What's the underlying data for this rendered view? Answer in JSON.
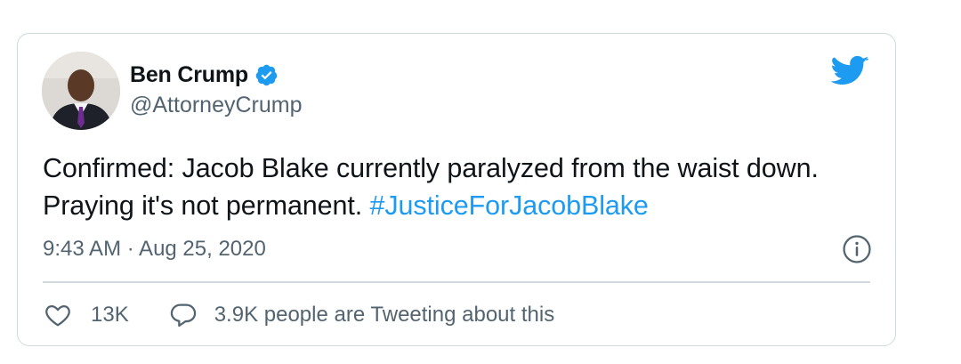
{
  "tweet": {
    "author": {
      "display_name": "Ben Crump",
      "handle": "@AttorneyCrump",
      "verified": true
    },
    "text": "Confirmed: Jacob Blake currently paralyzed from the waist down. Praying it's not permanent. ",
    "hashtag": "#JusticeForJacobBlake",
    "timestamp": "9:43 AM · Aug 25, 2020",
    "like_count": "13K",
    "tweeting_text": "3.9K people are Tweeting about this"
  },
  "icons": {
    "brand": "twitter-bird-icon",
    "verified": "verified-badge-icon",
    "info": "info-icon",
    "like": "heart-icon",
    "reply": "speech-bubble-icon"
  },
  "colors": {
    "brand_blue": "#1d9bf0",
    "text_primary": "#0f1419",
    "text_secondary": "#536471",
    "border": "#cfd9de"
  }
}
